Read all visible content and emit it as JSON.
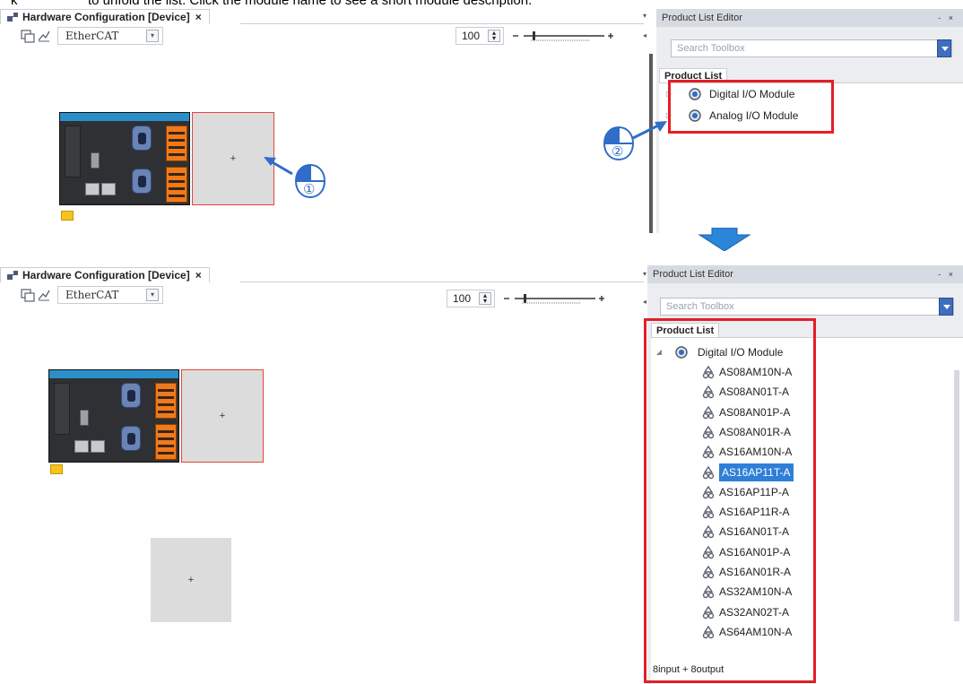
{
  "instruction": {
    "word1": "k",
    "word2": "to unfold the list. Click the module name to see a short module description."
  },
  "top": {
    "doc_tab": {
      "title": "Hardware Configuration [Device]",
      "close": "×"
    },
    "bus": "EtherCAT",
    "zoom": "100",
    "panel": {
      "title": "Product List Editor",
      "pin": "- ×",
      "search_placeholder": "Search Toolbox",
      "tab": "Product List",
      "items": [
        {
          "label": "Digital I/O Module",
          "expander": "▷"
        },
        {
          "label": "Analog I/O Module",
          "expander": "▷"
        }
      ]
    },
    "callouts": {
      "one": "①",
      "two": "②"
    }
  },
  "bottom": {
    "doc_tab": {
      "title": "Hardware Configuration [Device]",
      "close": "×"
    },
    "bus": "EtherCAT",
    "zoom": "100",
    "panel": {
      "title": "Product List Editor",
      "pin": "- ×",
      "search_placeholder": "Search Toolbox",
      "tab": "Product List",
      "root": {
        "label": "Digital I/O Module",
        "expander": "◢"
      },
      "children": [
        "AS08AM10N-A",
        "AS08AN01T-A",
        "AS08AN01P-A",
        "AS08AN01R-A",
        "AS16AM10N-A",
        "AS16AP11T-A",
        "AS16AP11P-A",
        "AS16AP11R-A",
        "AS16AN01T-A",
        "AS16AN01P-A",
        "AS16AN01R-A",
        "AS32AM10N-A",
        "AS32AN02T-A",
        "AS64AM10N-A"
      ],
      "selected_child": "AS16AP11T-A",
      "description": "8input + 8output"
    }
  },
  "colors": {
    "highlight_red": "#e51e25",
    "selection_blue": "#2f7fd8",
    "plc_banner": "#2b8fc9",
    "connector_orange": "#f07a1a"
  },
  "icons": [
    "window-icon",
    "layout-icon",
    "dropdown-arrow-icon",
    "spin-icon",
    "zoom-slider-icon",
    "gear-module-icon",
    "recycle-module-icon",
    "down-arrow-icon",
    "mouse-click-icon"
  ]
}
